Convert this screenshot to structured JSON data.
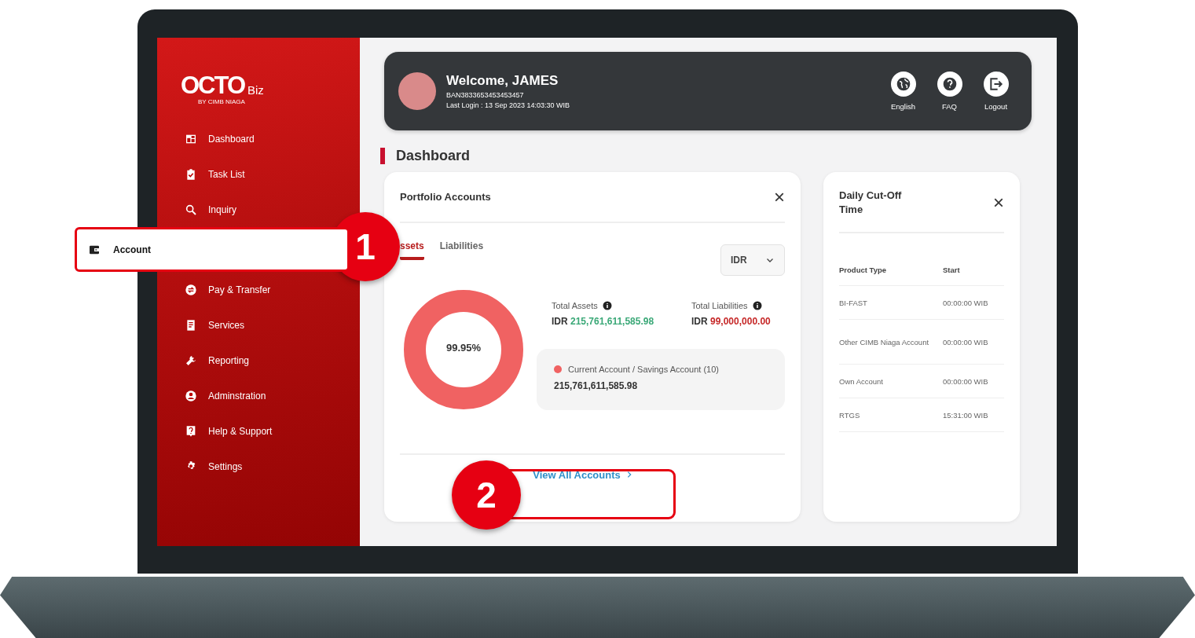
{
  "logo": {
    "name": "OCTO",
    "suffix": "Biz",
    "byline": "BY CIMB NIAGA"
  },
  "sidebar": {
    "items": [
      {
        "label": "Dashboard",
        "selected": false
      },
      {
        "label": "Task List",
        "selected": false
      },
      {
        "label": "Inquiry",
        "selected": false
      },
      {
        "label": "Account",
        "selected": true
      },
      {
        "label": "Pay & Transfer",
        "selected": false
      },
      {
        "label": "Services",
        "selected": false
      },
      {
        "label": "Reporting",
        "selected": false
      },
      {
        "label": "Adminstration",
        "selected": false
      },
      {
        "label": "Help & Support",
        "selected": false
      },
      {
        "label": "Settings",
        "selected": false
      }
    ]
  },
  "header": {
    "welcome": "Welcome, JAMES",
    "account_id": "BAN3833653453453457",
    "last_login": "Last Login : 13 Sep 2023 14:03:30 WIB",
    "actions": [
      {
        "label": "English"
      },
      {
        "label": "FAQ"
      },
      {
        "label": "Logout"
      }
    ]
  },
  "page_title": "Dashboard",
  "portfolio": {
    "title": "Portfolio Accounts",
    "close": "×",
    "tabs": [
      {
        "label": "ssets",
        "selected": true
      },
      {
        "label": "Liabilities",
        "selected": false
      }
    ],
    "currency": "IDR",
    "donut_label": "99.95%",
    "totals": [
      {
        "label": "Total Assets",
        "currency": "IDR",
        "amount": "215,761,611,585.98",
        "color": "#3aa877"
      },
      {
        "label": "Total Liabilities",
        "currency": "IDR",
        "amount": "99,000,000.00",
        "color": "#c62828"
      }
    ],
    "legend": [
      {
        "name": "Current Account / Savings Account (10)",
        "amount": "215,761,611,585.98",
        "color": "#f06262"
      }
    ],
    "link": "View All Accounts"
  },
  "cutoff": {
    "title": "Daily Cut-Off Time",
    "close": "×",
    "columns": [
      "Product Type",
      "Start"
    ],
    "rows": [
      [
        "BI-FAST",
        "00:00:00 WIB"
      ],
      [
        "Other CIMB Niaga Account",
        "00:00:00 WIB"
      ],
      [
        "Own Account",
        "00:00:00 WIB"
      ],
      [
        "RTGS",
        "15:31:00 WIB"
      ]
    ]
  },
  "callouts": [
    {
      "number": "1"
    },
    {
      "number": "2"
    }
  ]
}
